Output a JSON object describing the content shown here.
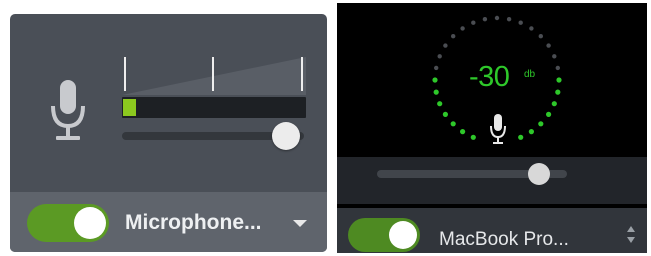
{
  "left_panel": {
    "mic_icon": "microphone-icon",
    "input_level": 0.07,
    "volume": 0.9,
    "enabled": true,
    "device_label": "Microphone...",
    "dropdown_icon": "caret-down-icon",
    "colors": {
      "level": "#8cc91f",
      "toggle_on": "#5b9a24"
    }
  },
  "right_panel": {
    "gauge_value": "-30",
    "gauge_unit": "db",
    "mic_icon": "microphone-icon",
    "volume": 0.85,
    "enabled": true,
    "device_label": "MacBook Pro...",
    "stepper_icon": "up-down-stepper-icon",
    "colors": {
      "gauge": "#2ec82a",
      "toggle_on": "#4e8a22"
    }
  }
}
